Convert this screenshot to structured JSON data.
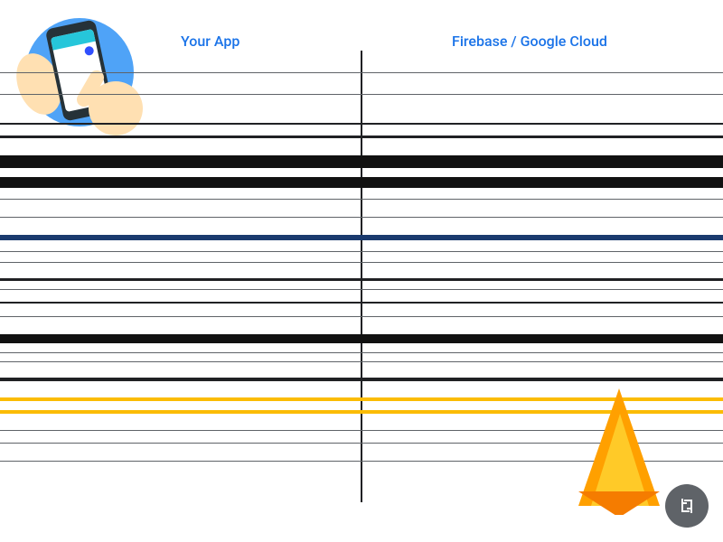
{
  "headers": {
    "left": "Your App",
    "right": "Firebase / Google Cloud"
  },
  "icons": {
    "app": "mobile-app-illustration",
    "firebase": "firebase-logo",
    "sync": "sync-icon"
  },
  "diagram_type": "two-column-streaked-architecture-diagram"
}
